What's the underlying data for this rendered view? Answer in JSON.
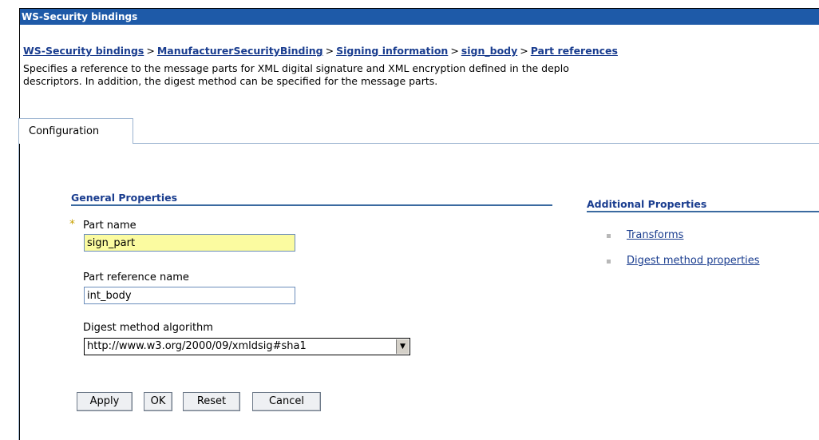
{
  "window": {
    "title": "WS-Security bindings"
  },
  "breadcrumb": [
    "WS-Security bindings",
    "ManufacturerSecurityBinding",
    "Signing information",
    "sign_body",
    "Part references"
  ],
  "breadcrumb_sep": ">",
  "description": "Specifies a reference to the message parts for XML digital signature and XML encryption defined in the deplo\ndescriptors. In addition, the digest method can be specified for the message parts.",
  "tabs": [
    {
      "label": "Configuration",
      "selected": true
    }
  ],
  "general": {
    "title": "General Properties",
    "required_marker": "*",
    "part_name": {
      "label": "Part name",
      "value": "sign_part",
      "required": true
    },
    "part_reference_name": {
      "label": "Part reference name",
      "value": "int_body"
    },
    "digest_method": {
      "label": "Digest method algorithm",
      "value": "http://www.w3.org/2000/09/xmldsig#sha1"
    }
  },
  "additional": {
    "title": "Additional Properties",
    "links": [
      "Transforms",
      "Digest method properties"
    ]
  },
  "buttons": {
    "apply": "Apply",
    "ok": "OK",
    "reset": "Reset",
    "cancel": "Cancel"
  },
  "colors": {
    "titlebar": "#1e5aa8",
    "link": "#1a3d8f",
    "required_field": "#fbfba0"
  }
}
